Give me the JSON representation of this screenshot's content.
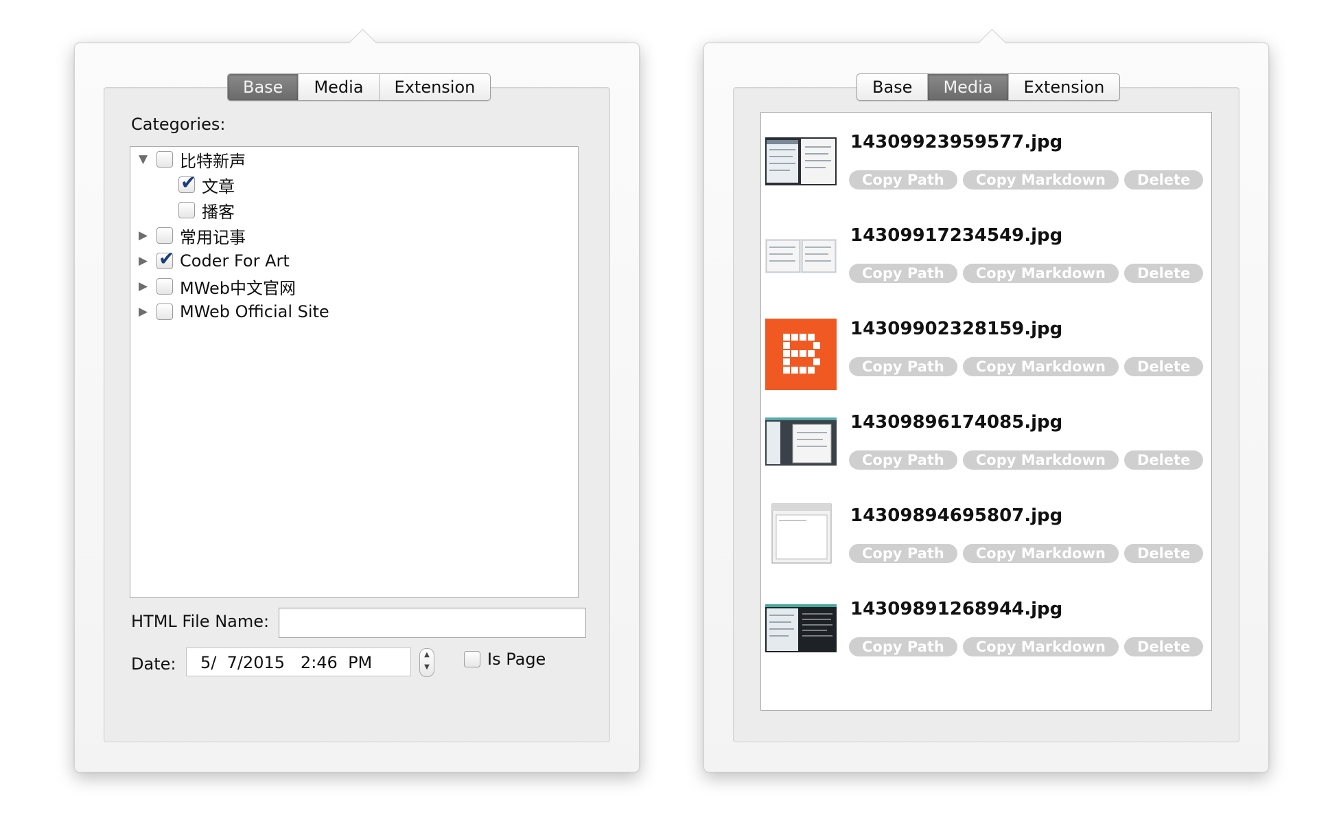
{
  "base_popover": {
    "tabs": [
      "Base",
      "Media",
      "Extension"
    ],
    "active_tab": "Base",
    "categories_label": "Categories:",
    "tree": [
      {
        "label": "比特新声",
        "checked": false,
        "expanded": true
      },
      {
        "label": "文章",
        "checked": true
      },
      {
        "label": "播客",
        "checked": false
      },
      {
        "label": "常用记事",
        "checked": false,
        "expanded": false
      },
      {
        "label": "Coder For Art",
        "checked": true,
        "expanded": false
      },
      {
        "label": "MWeb中文官网",
        "checked": false,
        "expanded": false
      },
      {
        "label": "MWeb Official Site",
        "checked": false,
        "expanded": false
      }
    ],
    "html_file_name_label": "HTML File Name:",
    "html_file_name_value": "",
    "date_label": "Date:",
    "date_value": "5/  7/2015   2:46  PM",
    "is_page_label": "Is Page",
    "is_page_checked": false,
    "icons": {
      "expanded": "disclosure-triangle-down-icon",
      "collapsed": "disclosure-triangle-right-icon",
      "stepper": "stepper-arrows-icon"
    }
  },
  "media_popover": {
    "tabs": [
      "Base",
      "Media",
      "Extension"
    ],
    "active_tab": "Media",
    "button_labels": {
      "copy_path": "Copy Path",
      "copy_markdown": "Copy Markdown",
      "delete": "Delete"
    },
    "items": [
      {
        "file": "14309923959577.jpg",
        "thumb": "screenshot"
      },
      {
        "file": "14309917234549.jpg",
        "thumb": "screenshot-light"
      },
      {
        "file": "14309902328159.jpg",
        "thumb": "blogger-logo"
      },
      {
        "file": "14309896174085.jpg",
        "thumb": "screenshot"
      },
      {
        "file": "14309894695807.jpg",
        "thumb": "window"
      },
      {
        "file": "14309891268944.jpg",
        "thumb": "screenshot-dark"
      }
    ]
  },
  "colors": {
    "active_tab": "#747474",
    "pill_button": "#cfcfcf",
    "blogger_orange": "#f05a22",
    "checkmark": "#1c3d7a"
  }
}
